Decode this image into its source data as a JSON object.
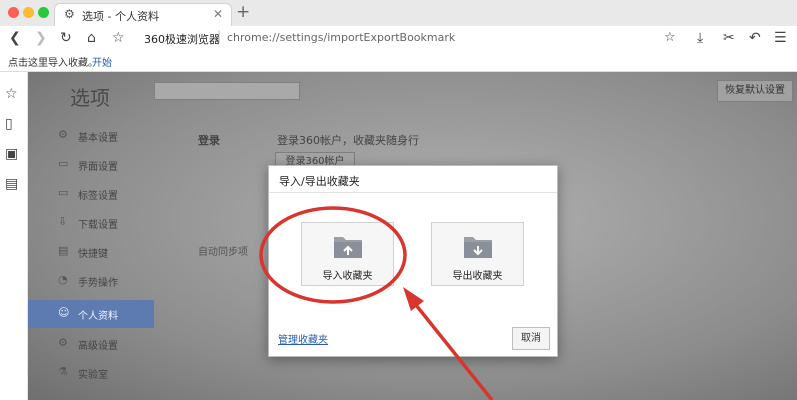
{
  "tab": {
    "title": "选项 - 个人资料",
    "new_tab_symbol": "+"
  },
  "address_bar": {
    "brand": "360极速浏览器",
    "separator": "|",
    "url": "chrome://settings/importExportBookmark"
  },
  "bookmark_bar": {
    "prompt": "点击这里导入收藏。",
    "start_link": "开始"
  },
  "settings": {
    "title": "选项",
    "restore_default": "恢复默认设置",
    "nav": [
      {
        "label": "基本设置",
        "icon": "gear-icon"
      },
      {
        "label": "界面设置",
        "icon": "window-icon"
      },
      {
        "label": "标签设置",
        "icon": "tab-icon"
      },
      {
        "label": "下载设置",
        "icon": "download-icon"
      },
      {
        "label": "快捷键",
        "icon": "keyboard-icon"
      },
      {
        "label": "手势操作",
        "icon": "mouse-icon"
      },
      {
        "label": "个人资料",
        "icon": "user-icon",
        "active": true
      },
      {
        "label": "高级设置",
        "icon": "advanced-icon"
      },
      {
        "label": "实验室",
        "icon": "lab-icon"
      }
    ],
    "login": {
      "label": "登录",
      "description": "登录360帐户，收藏夹随身行",
      "button": "登录360帐户"
    },
    "sync_label": "自动同步项"
  },
  "dialog": {
    "title": "导入/导出收藏夹",
    "import_label": "导入收藏夹",
    "export_label": "导出收藏夹",
    "manage_link": "管理收藏夹",
    "cancel": "取消"
  },
  "colors": {
    "accent_active_nav": "#5d7bb0",
    "link": "#2a5db0",
    "annotation": "#d8352e",
    "traffic_red": "#fc5f57",
    "traffic_yellow": "#fdbc2e",
    "traffic_green": "#28c840"
  }
}
